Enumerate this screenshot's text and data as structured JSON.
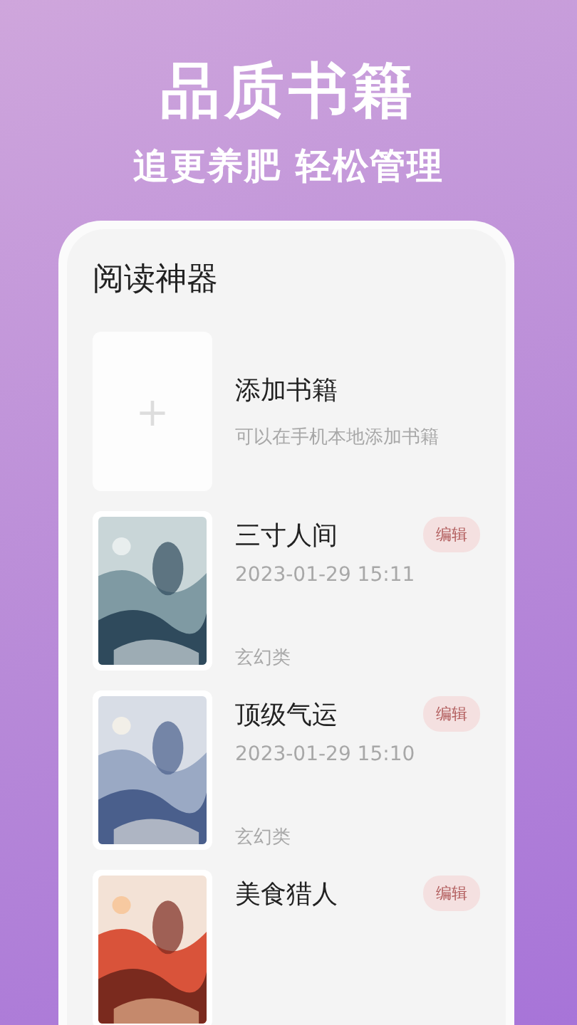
{
  "headline": "品质书籍",
  "subheadline": "追更养肥 轻松管理",
  "app_title": "阅读神器",
  "add_book": {
    "icon": "+",
    "title": "添加书籍",
    "hint": "可以在手机本地添加书籍"
  },
  "books": [
    {
      "title": "三寸人间",
      "date": "2023-01-29 15:11",
      "category": "玄幻类",
      "edit": "编辑"
    },
    {
      "title": "顶级气运",
      "date": "2023-01-29 15:10",
      "category": "玄幻类",
      "edit": "编辑"
    },
    {
      "title": "美食猎人",
      "edit": "编辑"
    }
  ]
}
